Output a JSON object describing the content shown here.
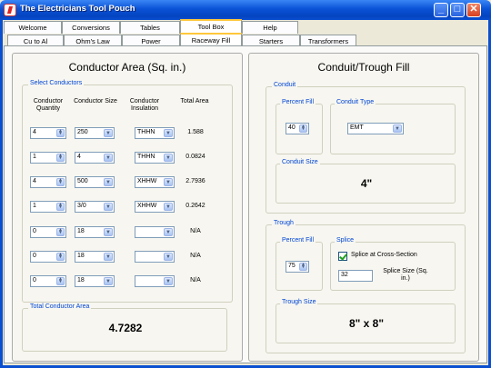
{
  "window": {
    "title": "The Electricians Tool Pouch"
  },
  "main_tabs": [
    "Welcome",
    "Conversions",
    "Tables",
    "Tool Box",
    "Help"
  ],
  "sub_tabs": [
    "Cu to Al",
    "Ohm's Law",
    "Power",
    "Raceway Fill",
    "Starters",
    "Transformers"
  ],
  "conductor_area": {
    "title": "Conductor Area (Sq. in.)",
    "select_group": "Select Conductors",
    "headers": {
      "quantity": "Conductor Quantity",
      "size": "Conductor Size",
      "insulation": "Conductor Insulation",
      "total": "Total Area"
    },
    "rows": [
      {
        "quantity": "4",
        "size": "250",
        "insulation": "THHN",
        "total": "1.588"
      },
      {
        "quantity": "1",
        "size": "4",
        "insulation": "THHN",
        "total": "0.0824"
      },
      {
        "quantity": "4",
        "size": "500",
        "insulation": "XHHW",
        "total": "2.7936"
      },
      {
        "quantity": "1",
        "size": "3/0",
        "insulation": "XHHW",
        "total": "0.2642"
      },
      {
        "quantity": "0",
        "size": "18",
        "insulation": "",
        "total": "N/A"
      },
      {
        "quantity": "0",
        "size": "18",
        "insulation": "",
        "total": "N/A"
      },
      {
        "quantity": "0",
        "size": "18",
        "insulation": "",
        "total": "N/A"
      }
    ],
    "total_group": "Total Conductor Area",
    "total_value": "4.7282"
  },
  "conduit_trough": {
    "title": "Conduit/Trough Fill",
    "conduit_group": "Conduit",
    "percent_fill_label": "Percent Fill",
    "conduit_percent": "40",
    "conduit_type_label": "Conduit Type",
    "conduit_type": "EMT",
    "conduit_size_label": "Conduit Size",
    "conduit_size": "4\"",
    "trough_group": "Trough",
    "trough_percent_label": "Percent Fill",
    "trough_percent": "75",
    "splice_label": "Splice",
    "splice_checkbox": "Splice at Cross-Section",
    "splice_size_value": "32",
    "splice_size_label": "Splice Size (Sq. in.)",
    "trough_size_label": "Trough Size",
    "trough_size": "8\" x 8\""
  }
}
